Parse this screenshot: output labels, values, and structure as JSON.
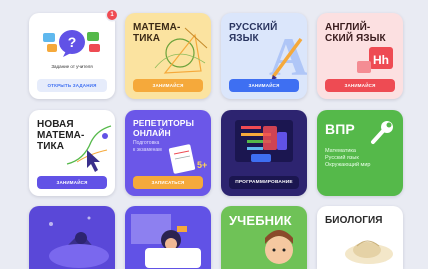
{
  "cards": [
    {
      "id": "help",
      "caption": "Задание от учителя",
      "button": "Открыть задания",
      "badge": "1",
      "accent": "#eff1f9"
    },
    {
      "id": "math",
      "title": "МАТЕМА-\nТИКА",
      "button": "Занимайся",
      "accent": "#f5a93b"
    },
    {
      "id": "russian",
      "title": "РУССКИЙ\nЯЗЫК",
      "button": "Занимайся",
      "accent": "#3e6ff2"
    },
    {
      "id": "english",
      "title": "АНГЛИЙ-\nСКИЙ ЯЗЫК",
      "button": "Занимайся",
      "accent": "#ee4b53"
    },
    {
      "id": "new_math",
      "title": "НОВАЯ\nМАТЕМА-\nТИКА",
      "button": "Занимайся",
      "accent": "#6152e6"
    },
    {
      "id": "tutors",
      "title": "РЕПЕТИТОРЫ\nОНЛАЙН",
      "subtitle": "Подготовка\nк экзаменам",
      "button": "Записаться",
      "accent": "#f5a93b"
    },
    {
      "id": "programming",
      "button": "Программирование",
      "accent": "#3a2f8c"
    },
    {
      "id": "vpr",
      "title": "ВПР",
      "subtitle": "Математика\nРусский язык\nОкружающий мир",
      "accent": "#55b94a"
    },
    {
      "id": "space"
    },
    {
      "id": "reading"
    },
    {
      "id": "textbook",
      "title": "УЧЕБНИК"
    },
    {
      "id": "biology",
      "title": "БИОЛОГИЯ"
    }
  ]
}
